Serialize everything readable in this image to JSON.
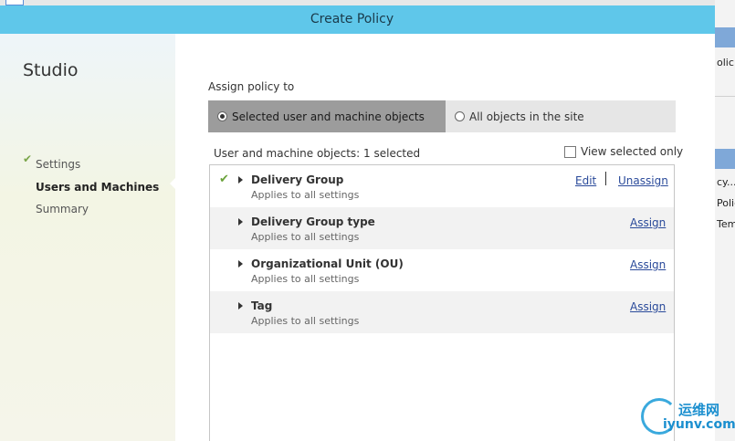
{
  "window": {
    "title": "Create Policy"
  },
  "sidebar": {
    "brand": "Studio",
    "steps": [
      {
        "label": "Settings",
        "status": "done",
        "check_icon": "checkmark-icon"
      },
      {
        "label": "Users and Machines",
        "status": "current"
      },
      {
        "label": "Summary",
        "status": "pending"
      }
    ]
  },
  "main": {
    "assign_label": "Assign policy to",
    "radio_options": [
      {
        "label": "Selected user and machine objects",
        "selected": true
      },
      {
        "label": "All objects in the site",
        "selected": false
      }
    ],
    "objects_label": "User and machine objects: 1 selected",
    "view_selected_label": "View selected only",
    "view_selected_checked": false,
    "rows": [
      {
        "name": "Delivery Group",
        "sub": "Applies to all settings",
        "assigned": true,
        "links": [
          "Edit",
          "Unassign"
        ]
      },
      {
        "name": "Delivery Group type",
        "sub": "Applies to all settings",
        "assigned": false,
        "links": [
          "Assign"
        ]
      },
      {
        "name": "Organizational Unit (OU)",
        "sub": "Applies to all settings",
        "assigned": false,
        "links": [
          "Assign"
        ]
      },
      {
        "name": "Tag",
        "sub": "Applies to all settings",
        "assigned": false,
        "links": [
          "Assign"
        ]
      }
    ]
  },
  "background": {
    "fragments": [
      "olic",
      "cy...",
      "Polic",
      "Tem"
    ]
  },
  "watermark": {
    "cn": "运维网",
    "en": "iyunv.com"
  },
  "colors": {
    "titlebar": "#5fc7ea",
    "check": "#6aa23a",
    "link": "#2a4a9a",
    "selected_radio_bg": "#9c9c9c"
  }
}
